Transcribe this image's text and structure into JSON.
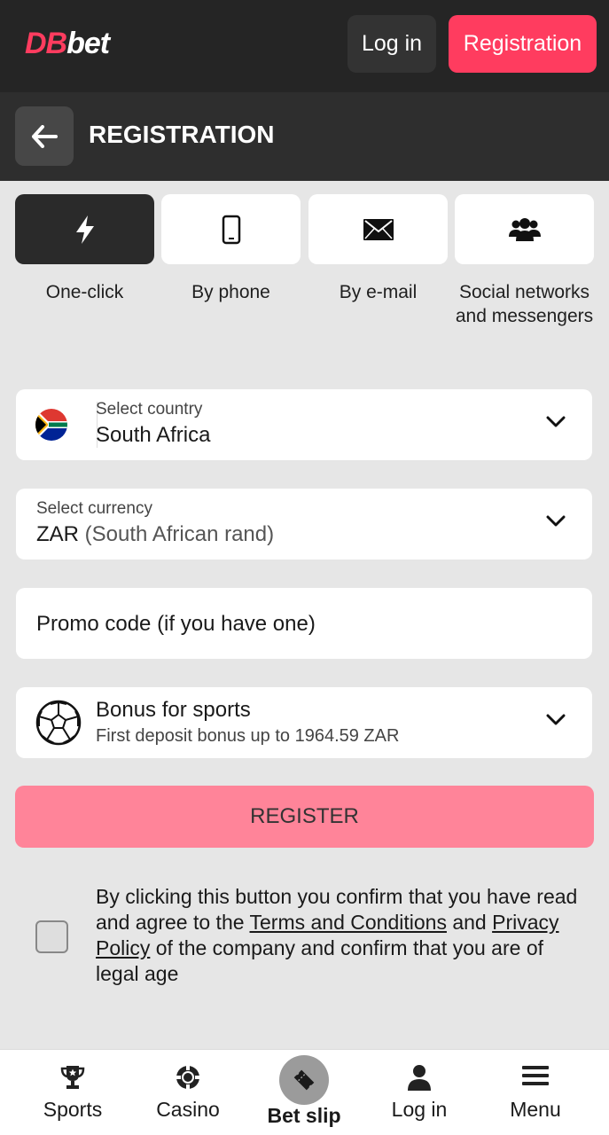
{
  "header": {
    "logo_db": "DB",
    "logo_bet": "bet",
    "login_label": "Log in",
    "registration_label": "Registration"
  },
  "titlebar": {
    "title": "REGISTRATION"
  },
  "tabs": [
    {
      "label": "One-click",
      "icon": "lightning-icon",
      "active": true
    },
    {
      "label": "By phone",
      "icon": "phone-icon",
      "active": false
    },
    {
      "label": "By e-mail",
      "icon": "envelope-icon",
      "active": false
    },
    {
      "label": "Social networks and messengers",
      "icon": "users-icon",
      "active": false
    }
  ],
  "country": {
    "label": "Select country",
    "value": "South Africa"
  },
  "currency": {
    "label": "Select currency",
    "code": "ZAR",
    "name": "(South African rand)"
  },
  "promo": {
    "placeholder": "Promo code (if you have one)"
  },
  "bonus": {
    "title": "Bonus for sports",
    "subtitle": "First deposit bonus up to 1964.59 ZAR"
  },
  "register_label": "REGISTER",
  "consent": {
    "part1": "By clicking this button you confirm that you have read and agree to the ",
    "terms_link": "Terms and Conditions",
    "part2": " and ",
    "privacy_link": "Privacy Policy",
    "part3": " of the company and confirm that you are of legal age"
  },
  "bottom_nav": {
    "sports": "Sports",
    "casino": "Casino",
    "betslip": "Bet slip",
    "login": "Log in",
    "menu": "Menu"
  },
  "colors": {
    "brand": "#ff3c5f",
    "register_button": "#ff8499",
    "header_bg": "#252525"
  }
}
